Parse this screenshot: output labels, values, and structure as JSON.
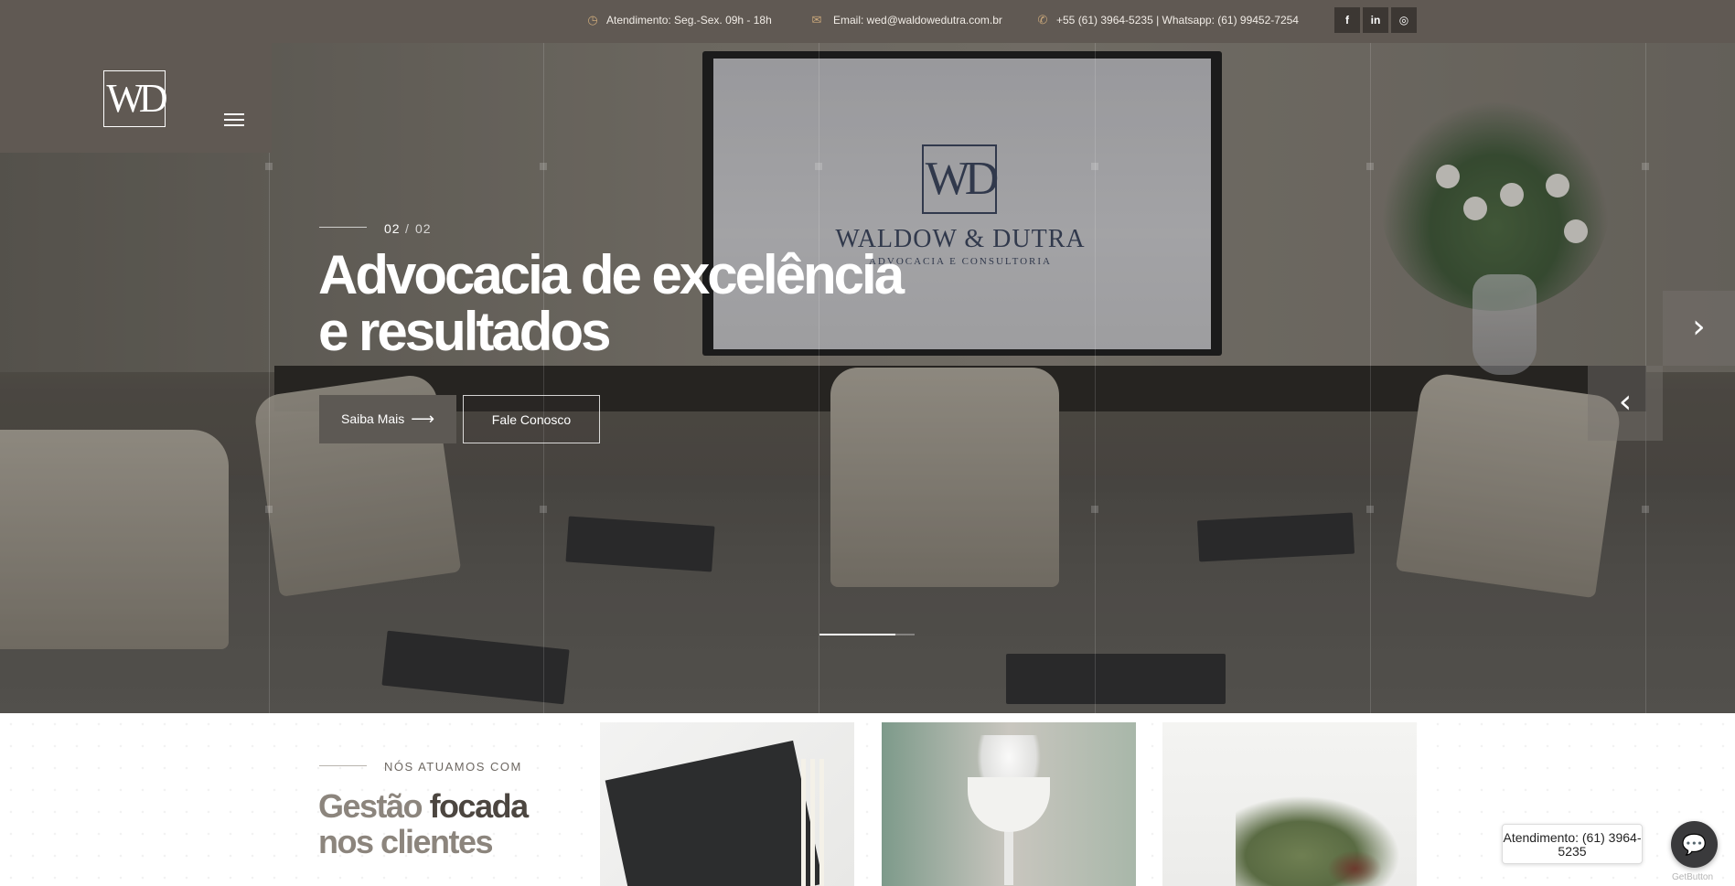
{
  "topbar": {
    "hours": "Atendimento: Seg.-Sex. 09h - 18h",
    "email": "Email: wed@waldowedutra.com.br",
    "phone": "+55 (61) 3964-5235 | Whatsapp: (61) 99452-7254",
    "hours_icon": "clock-icon",
    "email_icon": "envelope-icon",
    "phone_icon": "phone-icon",
    "social": [
      {
        "name": "facebook-icon",
        "glyph": "f"
      },
      {
        "name": "linkedin-icon",
        "glyph": "in"
      },
      {
        "name": "instagram-icon",
        "glyph": "◎"
      }
    ]
  },
  "logo": {
    "monogram": "WD"
  },
  "hero": {
    "slide_current": "02",
    "slide_separator": "/",
    "slide_total": "02",
    "title_line1": "Advocacia de excelência",
    "title_line2": "e resultados",
    "btn_primary": "Saiba Mais",
    "btn_secondary": "Fale Conosco",
    "progress": 0.8,
    "screen_brand": "WALDOW & DUTRA",
    "screen_sub": "ADVOCACIA E CONSULTORIA",
    "screen_monogram": "WD"
  },
  "section": {
    "label": "NÓS ATUAMOS COM",
    "title_light": "Gestão",
    "title_dark": "focada",
    "title_line2": "nos clientes"
  },
  "chat": {
    "tooltip": "Atendimento: (61) 3964-5235",
    "credit": "GetButton"
  },
  "colors": {
    "topbar": "#605953",
    "accent": "#c9a77a",
    "button": "#5d5954"
  }
}
